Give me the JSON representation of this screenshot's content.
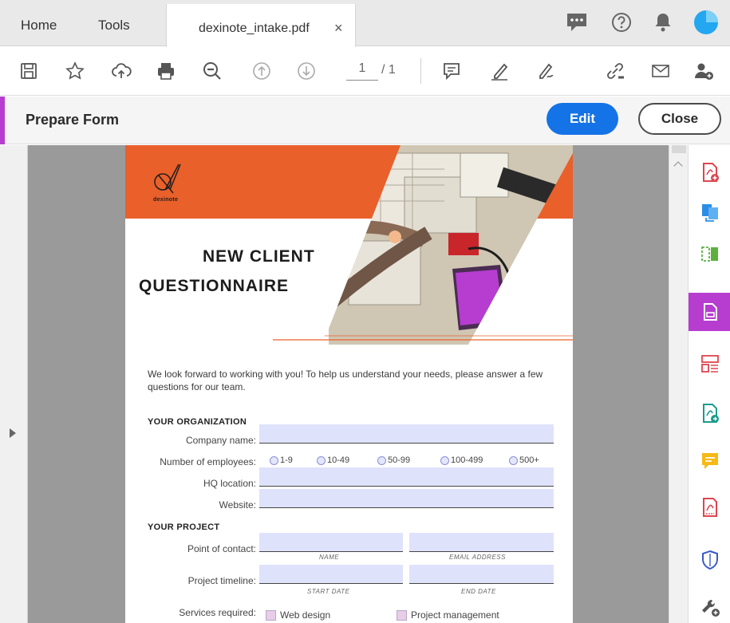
{
  "tabs": {
    "home": "Home",
    "tools": "Tools",
    "document": "dexinote_intake.pdf",
    "close_symbol": "×"
  },
  "toolbar": {
    "page_current": "1",
    "page_total": "/ 1"
  },
  "prepare": {
    "title": "Prepare Form",
    "edit_label": "Edit",
    "close_label": "Close"
  },
  "doc": {
    "logo_text": "dexinote",
    "title_line1": "NEW CLIENT",
    "title_line2": "QUESTIONNAIRE",
    "intro": "We look forward to working with you! To help us understand your needs, please answer a few questions for our team.",
    "org_heading": "YOUR ORGANIZATION",
    "company_label": "Company name:",
    "employees_label": "Number of employees:",
    "employee_options": [
      "1-9",
      "10-49",
      "50-99",
      "100-499",
      "500+"
    ],
    "hq_label": "HQ location:",
    "website_label": "Website:",
    "project_heading": "YOUR PROJECT",
    "contact_label": "Point of contact:",
    "name_sub": "NAME",
    "email_sub": "EMAIL ADDRESS",
    "timeline_label": "Project timeline:",
    "start_sub": "START DATE",
    "end_sub": "END DATE",
    "services_label": "Services required:",
    "services": [
      "Web design",
      "Project management"
    ]
  },
  "colors": {
    "accent_purple": "#b63dcf",
    "primary_blue": "#1473e6",
    "banner_orange": "#e9602b",
    "field_fill": "#dfe2fb"
  }
}
